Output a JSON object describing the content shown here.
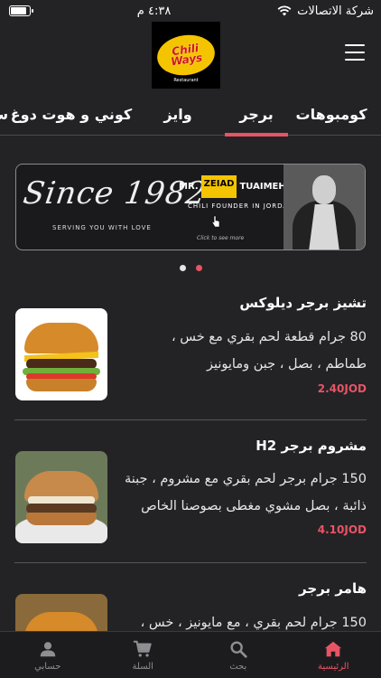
{
  "status_bar": {
    "carrier": "شركة الاتصالات",
    "time": "٤:٣٨ م",
    "battery_level": 0.9
  },
  "header": {
    "logo_text_1": "Chili",
    "logo_text_2": "Ways",
    "logo_sub": "Restaurant"
  },
  "tabs": [
    {
      "label": "كومبوهات",
      "active": false
    },
    {
      "label": "برجر",
      "active": true
    },
    {
      "label": "وايز",
      "active": false
    },
    {
      "label": "كوني و هوت دوغ",
      "active": false
    },
    {
      "label": "س",
      "active": false
    }
  ],
  "banner": {
    "since": "Since 1982",
    "serving": "SERVING YOU WITH LOVE",
    "mr": "MR.",
    "first_name": "ZEIAD",
    "last_name": "TUAIMEH",
    "founder": "CHILI FOUNDER IN JORDAN",
    "click": "Click to see more"
  },
  "pager": {
    "count": 2,
    "active_index": 1
  },
  "products": [
    {
      "name": "تشيز برجر ديلوكس",
      "desc_line1": "80 جرام قطعة لحم بقري مع خس ،",
      "desc_line2": "طماطم ، بصل ، جبن ومايونيز",
      "price": "2.40JOD"
    },
    {
      "name": "مشروم برجر H2",
      "desc_line1": "150 جرام برجر لحم بقري مع مشروم ، جبنة",
      "desc_line2": "ذائبة ، بصل مشوي مغطى بصوصنا الخاص",
      "price": "4.10JOD"
    },
    {
      "name": "هامر برجر",
      "desc_line1": "150 جرام لحم بقري ، مع مايونيز ، خس ،",
      "desc_line2": "",
      "price": ""
    }
  ],
  "bottom_nav": [
    {
      "label": "الرئيسية",
      "icon": "home-icon",
      "active": true
    },
    {
      "label": "بحث",
      "icon": "search-icon",
      "active": false
    },
    {
      "label": "السلة",
      "icon": "cart-icon",
      "active": false
    },
    {
      "label": "حسابي",
      "icon": "user-icon",
      "active": false
    }
  ],
  "colors": {
    "accent": "#e85464",
    "background": "#232326",
    "logo_yellow": "#f5c400",
    "logo_red": "#d0161c"
  }
}
